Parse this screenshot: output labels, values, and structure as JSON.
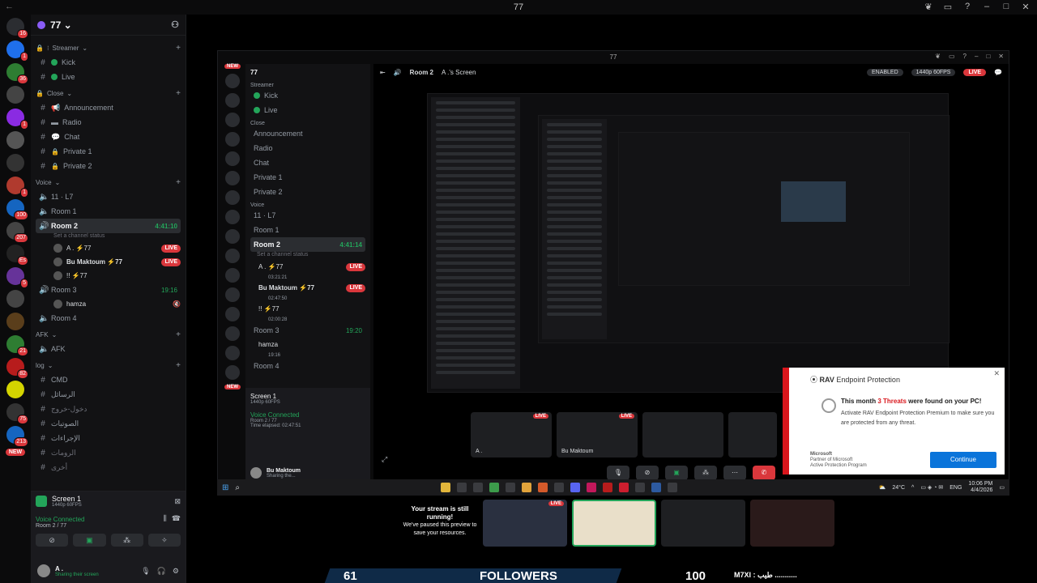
{
  "titlebar": {
    "title": "77",
    "back": "←"
  },
  "rail": {
    "badges": [
      "16",
      "1",
      "36",
      "",
      "1",
      "",
      "",
      "1",
      "100",
      "207",
      "Es",
      "5",
      "",
      "",
      "21",
      "82",
      "",
      "75",
      "213"
    ],
    "new_label": "NEW"
  },
  "server": {
    "name": "77 ⌄"
  },
  "sidebar": {
    "categories": {
      "streamer": "Streamer",
      "close": "Close",
      "voice": "Voice",
      "afk": "AFK",
      "log": "log"
    },
    "streamer_channels": [
      "Kick",
      "Live"
    ],
    "close_channels": [
      "Announcement",
      "Radio",
      "Chat",
      "Private 1",
      "Private 2"
    ],
    "voice_channels": {
      "c1": "11 · L7",
      "c2": "Room 1",
      "c3": "Room 2",
      "c3_time": "4:41:10",
      "c3_status": "Set a channel status",
      "c4": "Room 3",
      "c4_time": "19:16",
      "c5": "Room 4"
    },
    "room2_users": [
      {
        "name": "A . ⚡77",
        "live": "LIVE"
      },
      {
        "name": "Bu Maktoum ⚡77",
        "live": "LIVE"
      },
      {
        "name": "!! ⚡77",
        "live": ""
      }
    ],
    "room3_users": [
      {
        "name": "hamza"
      }
    ],
    "afk_channel": "AFK",
    "log_channels": [
      "CMD",
      "الرسائل",
      "دخول-خروج",
      "الصوتيات",
      "الإجراءات",
      "الرومات",
      "أخرى"
    ]
  },
  "voice_panel": {
    "screen_title": "Screen 1",
    "screen_sub": "1440p 60FPS",
    "connected": "Voice Connected",
    "room": "Room 2 / 77"
  },
  "user_panel": {
    "name": "A .",
    "status": "Sharing their screen"
  },
  "stream": {
    "title": "77",
    "channel": "Room 2",
    "screen_of": "A .'s Screen",
    "enabled": "ENABLED",
    "quality": "1440p 60FPS",
    "live": "LIVE",
    "inner_server": "77",
    "inner_streamer": "Streamer",
    "inner_kick": "Kick",
    "inner_live": "Live",
    "inner_close": "Close",
    "inner_ann": "Announcement",
    "inner_radio": "Radio",
    "inner_chat": "Chat",
    "inner_p1": "Private 1",
    "inner_p2": "Private 2",
    "inner_voice": "Voice",
    "inner_l7": "11 · L7",
    "inner_r1": "Room 1",
    "inner_r2": "Room 2",
    "inner_r2_time": "4:41:14",
    "inner_r2_status": "Set a channel status",
    "inner_u1": "A . ⚡77",
    "inner_u1_time": "03:21:21",
    "inner_u2": "Bu Maktoum ⚡77",
    "inner_u2_time": "02:47:50",
    "inner_u3": "!! ⚡77",
    "inner_u3_time": "02:00:28",
    "inner_r3": "Room 3",
    "inner_r3_time": "19:20",
    "inner_hamza": "hamza",
    "inner_hamza_time": "19:16",
    "inner_r4": "Room 4",
    "inner_new": "NEW",
    "inner_screen": "Screen 1",
    "inner_screen_sub": "1440p 60FPS",
    "inner_connected": "Voice Connected",
    "inner_room": "Room 2 / 77",
    "inner_elapsed": "Time elapsed: 02:47:51",
    "inner_user": "Bu Maktoum",
    "inner_user_status": "Sharing the...",
    "tile_labels": [
      "A .",
      "Bu Maktoum"
    ]
  },
  "rav": {
    "brand": "RAV",
    "brand_rest": "Endpoint Protection",
    "headline_pre": "This month ",
    "headline_red": "3 Threats",
    "headline_post": " were found on your PC!",
    "body": "Activate RAV Endpoint Protection Premium to make sure you are protected from any threat.",
    "ms1": "Microsoft",
    "ms2": "Partner of Microsoft",
    "ms3": "Active Protection Program",
    "continue": "Continue"
  },
  "taskbar": {
    "temp": "24°C",
    "lang": "ENG",
    "time": "10:06 PM",
    "date": "4/4/2026"
  },
  "paused": {
    "title": "Your stream is still running!",
    "body": "We've paused this preview to save your resources."
  },
  "bottom": {
    "live": "LIVE"
  },
  "overlay": {
    "count1": "61",
    "followers": "FOLLOWERS",
    "count2": "100",
    "ticker": "M7XI : طيب ..........."
  },
  "colors": {
    "accent": "#23a55a",
    "live": "#da373c",
    "rav_red": "#d9161c",
    "rav_btn": "#0a74da"
  }
}
